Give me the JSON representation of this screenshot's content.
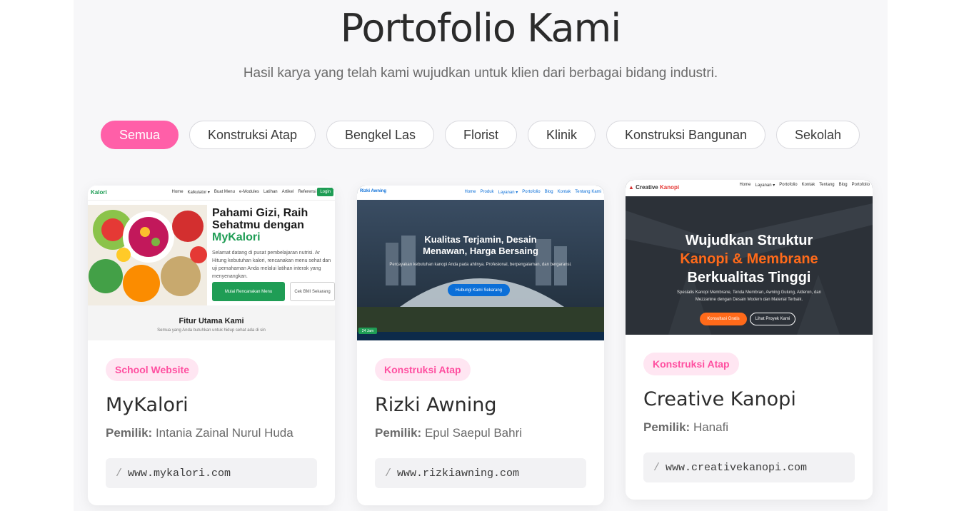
{
  "header": {
    "title": "Portofolio Kami",
    "subtitle": "Hasil karya yang telah kami wujudkan untuk klien dari berbagai bidang industri."
  },
  "filters": [
    "Semua",
    "Konstruksi Atap",
    "Bengkel Las",
    "Florist",
    "Klinik",
    "Konstruksi Bangunan",
    "Sekolah"
  ],
  "active_filter": "Semua",
  "colors": {
    "accent": "#ff5fa8",
    "tag_bg": "#ffe6f2",
    "tag_text": "#ff4fa0"
  },
  "cards": [
    {
      "tag": "School Website",
      "name": "MyKalori",
      "owner_label": "Pemilik:",
      "owner": "Intania Zainal Nurul Huda",
      "url_prefix": "/",
      "url": "www.mykalori.com",
      "thumb": {
        "logo": "Kalori",
        "nav": [
          "Home",
          "Kalkulator ▾",
          "Buat Menu",
          "e-Modules",
          "Latihan",
          "Artikel",
          "Referensi"
        ],
        "nav_button": "Login",
        "hero_line1": "Pahami Gizi, Raih",
        "hero_line2": "Sehatmu dengan",
        "hero_brand": "MyKalori",
        "hero_text": "Selamat datang di pusat pembelajaran nutrisi. Ar Hitung kebutuhan kalori, rencanakan menu sehat dan uji pemahaman Anda melalui latihan interak yang menyenangkan.",
        "btn_primary": "Mulai Rencanakan Menu",
        "btn_secondary": "Cek BMI Sekarang",
        "feature_title": "Fitur Utama Kami",
        "feature_text": "Semua yang Anda butuhkan untuk hidup sehat ada di sin"
      }
    },
    {
      "tag": "Konstruksi Atap",
      "name": "Rizki Awning",
      "owner_label": "Pemilik:",
      "owner": "Epul Saepul Bahri",
      "url_prefix": "/",
      "url": "www.rizkiawning.com",
      "thumb": {
        "logo": "Rizki Awning",
        "nav": [
          "Home",
          "Produk",
          "Layanan ▾",
          "Portofolio",
          "Blog",
          "Kontak",
          "Tentang Kami"
        ],
        "hero_line1": "Kualitas Terjamin, Desain",
        "hero_line2": "Menawan, Harga Bersaing",
        "hero_text": "Percayakan kebutuhan kanopi Anda pada ahlinya. Profesional, berpengalaman, dan bergaransi.",
        "btn_primary": "Hubungi Kami Sekarang",
        "badge": "24 Jam"
      }
    },
    {
      "tag": "Konstruksi Atap",
      "name": "Creative Kanopi",
      "owner_label": "Pemilik:",
      "owner": "Hanafi",
      "url_prefix": "/",
      "url": "www.creativekanopi.com",
      "thumb": {
        "logo_a": "Creative",
        "logo_b": "Kanopi",
        "nav": [
          "Home",
          "Layanan ▾",
          "Portofolio",
          "Kontak",
          "Tentang",
          "Blog",
          "Portofolio"
        ],
        "hero_line1": "Wujudkan Struktur",
        "hero_line2": "Kanopi & Membrane",
        "hero_line3": "Berkualitas Tinggi",
        "hero_text": "Spesialis Kanopi Membrane, Tenda Membran, Awning Gulung, Alderon, dan Mezzanine dengan Desain Modern dan Material Terbaik.",
        "btn_primary": "Konsultasi Gratis",
        "btn_secondary": "Lihat Proyek Kami"
      }
    }
  ]
}
